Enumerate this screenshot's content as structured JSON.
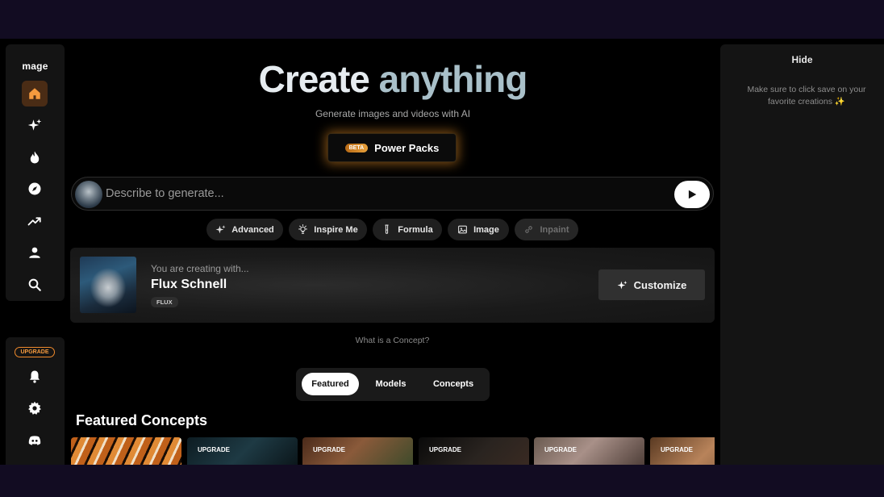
{
  "sidebar": {
    "logo": "mage",
    "nav": [
      {
        "name": "home",
        "icon": "home-icon",
        "active": true
      },
      {
        "name": "sparkles",
        "icon": "sparkles-icon"
      },
      {
        "name": "fire",
        "icon": "fire-icon"
      },
      {
        "name": "explore",
        "icon": "compass-icon"
      },
      {
        "name": "trending",
        "icon": "trending-icon"
      },
      {
        "name": "profile",
        "icon": "user-icon"
      },
      {
        "name": "search",
        "icon": "search-icon"
      }
    ],
    "upgrade_label": "UPGRADE",
    "bottom": [
      {
        "name": "notifications",
        "icon": "bell-icon"
      },
      {
        "name": "settings",
        "icon": "gear-icon"
      },
      {
        "name": "discord",
        "icon": "discord-icon"
      }
    ]
  },
  "hero": {
    "title_part1": "Create",
    "title_part2": "anything",
    "subtitle": "Generate images and videos with AI"
  },
  "power_packs": {
    "badge": "BETA",
    "label": "Power Packs"
  },
  "prompt": {
    "placeholder": "Describe to generate..."
  },
  "chips": [
    {
      "label": "Advanced",
      "icon": "sparkles-icon",
      "enabled": true
    },
    {
      "label": "Inspire Me",
      "icon": "lightbulb-icon",
      "enabled": true
    },
    {
      "label": "Formula",
      "icon": "test-tube-icon",
      "enabled": true
    },
    {
      "label": "Image",
      "icon": "image-icon",
      "enabled": true
    },
    {
      "label": "Inpaint",
      "icon": "link-icon",
      "enabled": false
    }
  ],
  "model": {
    "caption": "You are creating with...",
    "name": "Flux Schnell",
    "tag": "FLUX",
    "customize_label": "Customize"
  },
  "concept_link": "What is a Concept?",
  "tabs": [
    {
      "label": "Featured",
      "active": true
    },
    {
      "label": "Models",
      "active": false
    },
    {
      "label": "Concepts",
      "active": false
    }
  ],
  "section_title": "Featured Concepts",
  "thumbnails": [
    {
      "badge": ""
    },
    {
      "badge": "UPGRADE"
    },
    {
      "badge": "UPGRADE"
    },
    {
      "badge": "UPGRADE"
    },
    {
      "badge": "UPGRADE"
    },
    {
      "badge": "UPGRADE"
    }
  ],
  "right_panel": {
    "hide_label": "Hide",
    "note": "Make sure to click save on your favorite creations ✨"
  },
  "colors": {
    "accent": "#f08a2c",
    "active_nav": "#4a2c15",
    "background": "#000000"
  }
}
